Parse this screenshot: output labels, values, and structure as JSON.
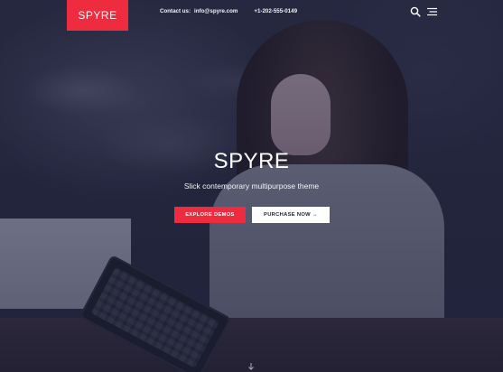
{
  "brand": {
    "logo_text": "SPYRE",
    "accent": "#ef2b3f"
  },
  "header": {
    "contact_label": "Contact us:",
    "email": "info@spyre.com",
    "phone": "+1-202-555-0149",
    "icons": [
      "search-icon",
      "menu-icon"
    ]
  },
  "hero": {
    "title": "SPYRE",
    "subtitle": "Slick contemporary multipurpose theme",
    "buttons": {
      "primary": "EXPLORE DEMOS",
      "secondary": "PURCHASE NOW →"
    },
    "scroll_icon": "arrow-down-icon"
  }
}
